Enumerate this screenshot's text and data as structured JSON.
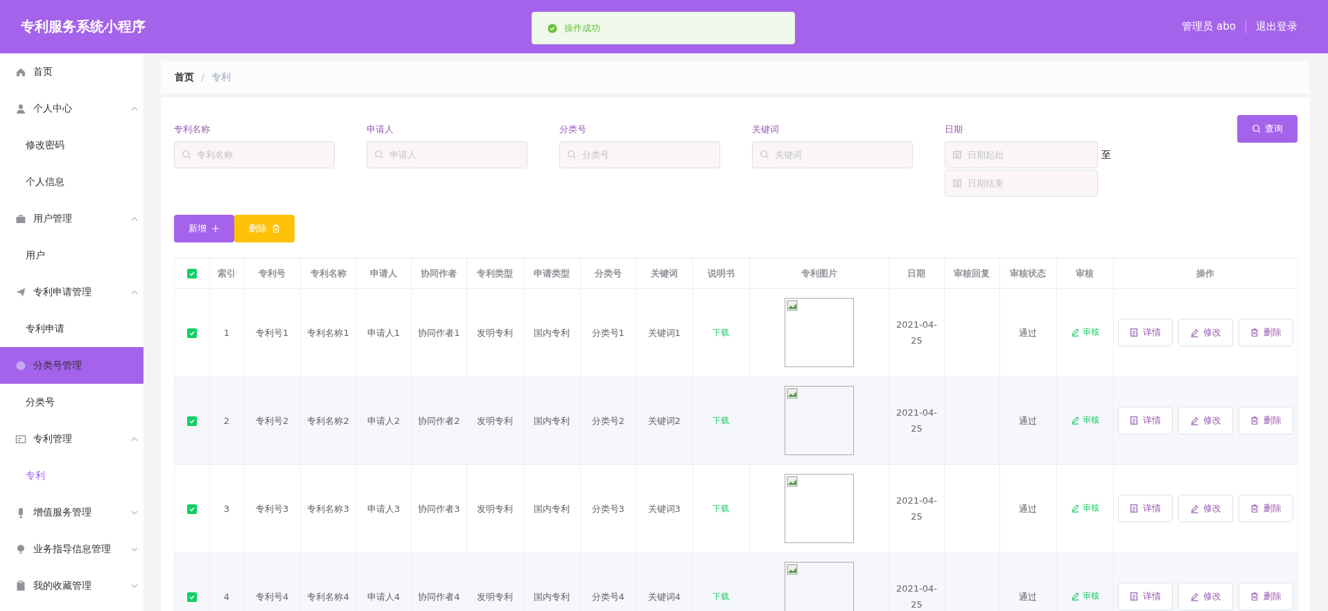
{
  "header": {
    "title": "专利服务系统小程序",
    "user": "管理员 abo",
    "logout": "退出登录"
  },
  "toast": {
    "message": "操作成功"
  },
  "sidebar": {
    "items": [
      {
        "label": "首页",
        "hovered": false
      },
      {
        "label": "个人中心",
        "hovered": false,
        "expanded": true,
        "children": [
          {
            "label": "修改密码",
            "selected": false
          },
          {
            "label": "个人信息",
            "selected": false
          }
        ]
      },
      {
        "label": "用户管理",
        "hovered": false,
        "expanded": true,
        "children": [
          {
            "label": "用户",
            "selected": false
          }
        ]
      },
      {
        "label": "专利申请管理",
        "hovered": false,
        "expanded": true,
        "children": [
          {
            "label": "专利申请",
            "selected": false
          }
        ]
      },
      {
        "label": "分类号管理",
        "hovered": true,
        "expanded": true,
        "children": [
          {
            "label": "分类号",
            "selected": false
          }
        ]
      },
      {
        "label": "专利管理",
        "hovered": false,
        "expanded": true,
        "children": [
          {
            "label": "专利",
            "selected": true
          }
        ]
      },
      {
        "label": "增值服务管理",
        "hovered": false,
        "expanded": false
      },
      {
        "label": "业务指导信息管理",
        "hovered": false,
        "expanded": false
      },
      {
        "label": "我的收藏管理",
        "hovered": false,
        "expanded": false
      }
    ]
  },
  "breadcrumb": {
    "separator": "/",
    "items": [
      "首页",
      "专利"
    ]
  },
  "filters": [
    {
      "label": "专利名称",
      "placeholder": "专利名称"
    },
    {
      "label": "申请人",
      "placeholder": "申请人"
    },
    {
      "label": "分类号",
      "placeholder": "分类号"
    },
    {
      "label": "关键词",
      "placeholder": "关键词"
    }
  ],
  "date_filter": {
    "label": "日期",
    "start_placeholder": "日期起始",
    "end_placeholder": "日期结束",
    "separator": "至"
  },
  "query_button": "查询",
  "add_button": "新增",
  "delete_button": "删除",
  "table": {
    "all_checked": true,
    "columns": [
      "索引",
      "专利号",
      "专利名称",
      "申请人",
      "协同作者",
      "专利类型",
      "申请类型",
      "分类号",
      "关键词",
      "说明书",
      "专利图片",
      "日期",
      "审核回复",
      "审核状态",
      "审核",
      "操作"
    ],
    "rows": [
      {
        "checked": true,
        "index": "1",
        "number": "专利号1",
        "name": "专利名称1",
        "applicant": "申请人1",
        "coauthor": "协同作者1",
        "patent_type": "发明专利",
        "apply_type": "国内专利",
        "class_no": "分类号1",
        "keyword": "关键词1",
        "manual": "下载",
        "date": "2021-04-25",
        "status": "通过",
        "review": "审核",
        "actions": [
          "详情",
          "修改",
          "删除"
        ]
      },
      {
        "checked": true,
        "index": "2",
        "number": "专利号2",
        "name": "专利名称2",
        "applicant": "申请人2",
        "coauthor": "协同作者2",
        "patent_type": "发明专利",
        "apply_type": "国内专利",
        "class_no": "分类号2",
        "keyword": "关键词2",
        "manual": "下载",
        "date": "2021-04-25",
        "status": "通过",
        "review": "审核",
        "actions": [
          "详情",
          "修改",
          "删除"
        ]
      },
      {
        "checked": true,
        "index": "3",
        "number": "专利号3",
        "name": "专利名称3",
        "applicant": "申请人3",
        "coauthor": "协同作者3",
        "patent_type": "发明专利",
        "apply_type": "国内专利",
        "class_no": "分类号3",
        "keyword": "关键词3",
        "manual": "下载",
        "date": "2021-04-25",
        "status": "通过",
        "review": "审核",
        "actions": [
          "详情",
          "修改",
          "删除"
        ]
      },
      {
        "checked": true,
        "index": "4",
        "number": "专利号4",
        "name": "专利名称4",
        "applicant": "申请人4",
        "coauthor": "协同作者4",
        "patent_type": "发明专利",
        "apply_type": "国内专利",
        "class_no": "分类号4",
        "keyword": "关键词4",
        "manual": "下载",
        "date": "2021-04-25",
        "status": "通过",
        "review": "审核",
        "actions": [
          "详情",
          "修改",
          "删除"
        ]
      }
    ]
  }
}
